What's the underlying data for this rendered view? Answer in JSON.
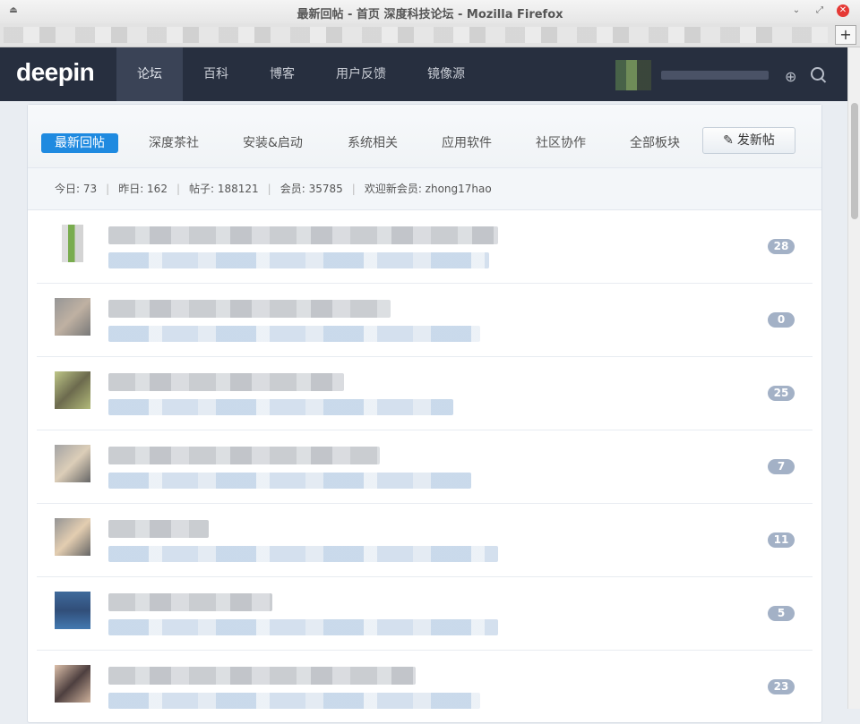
{
  "window": {
    "title": "最新回帖 - 首页 深度科技论坛 - Mozilla Firefox",
    "new_tab_label": "+"
  },
  "site": {
    "logo": "deepin"
  },
  "nav": {
    "items": [
      {
        "label": "论坛",
        "active": true
      },
      {
        "label": "百科",
        "active": false
      },
      {
        "label": "博客",
        "active": false
      },
      {
        "label": "用户反馈",
        "active": false
      },
      {
        "label": "镜像源",
        "active": false
      }
    ]
  },
  "icons": {
    "globe": "globe-icon",
    "search": "search-icon",
    "pencil": "pencil-icon"
  },
  "tabs": [
    {
      "label": "最新回帖",
      "active": true
    },
    {
      "label": "深度茶社",
      "active": false
    },
    {
      "label": "安装&启动",
      "active": false
    },
    {
      "label": "系统相关",
      "active": false
    },
    {
      "label": "应用软件",
      "active": false
    },
    {
      "label": "社区协作",
      "active": false
    },
    {
      "label": "全部板块",
      "active": false
    }
  ],
  "post_button": "发新帖",
  "stats": {
    "today": "今日: 73",
    "yesterday": "昨日: 162",
    "posts": "帖子: 188121",
    "members": "会员: 35785",
    "newest": "欢迎新会员: zhong17hao"
  },
  "threads": [
    {
      "replies": "28"
    },
    {
      "replies": "0"
    },
    {
      "replies": "25"
    },
    {
      "replies": "7"
    },
    {
      "replies": "11"
    },
    {
      "replies": "5"
    },
    {
      "replies": "23"
    }
  ],
  "colors": {
    "accent": "#1f8ae0",
    "navbar": "#272f3f",
    "badge": "#a3b1c6"
  }
}
